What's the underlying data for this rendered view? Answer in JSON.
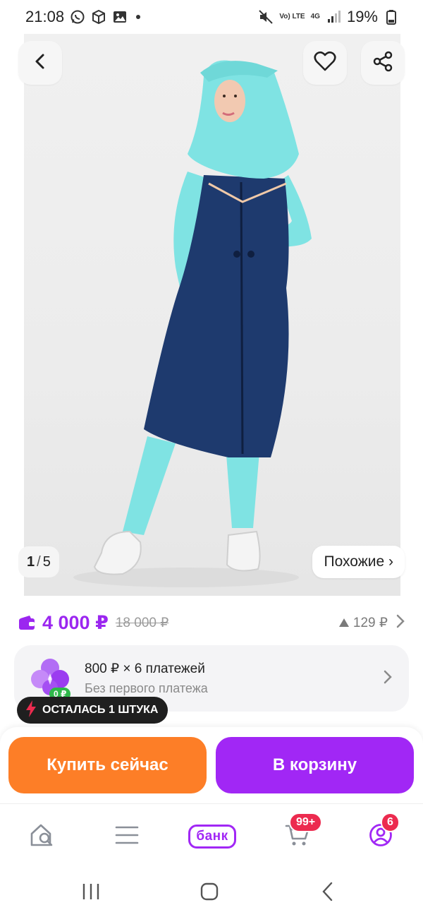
{
  "status_bar": {
    "time": "21:08",
    "battery": "19%",
    "network": "4G",
    "volte": "Vo) LTE"
  },
  "gallery": {
    "current": "1",
    "separator": "/",
    "total": "5",
    "similar_label": "Похожие ›"
  },
  "product": {
    "price": "4 000 ₽",
    "old_price": "18 000 ₽",
    "points": "129 ₽",
    "colors": {
      "price": "#9b26f0",
      "outfit_dark": "#1e3a6e",
      "outfit_light": "#7fe3e3"
    }
  },
  "installment": {
    "title": "800 ₽ × 6 платежей",
    "subtitle": "Без первого платежа",
    "badge": "0 ₽"
  },
  "stock": {
    "label": "ОСТАЛАСЬ 1 ШТУКА"
  },
  "actions": {
    "buy_now": "Купить сейчас",
    "add_to_cart": "В корзину",
    "colors": {
      "buy": "#fd7e27",
      "cart": "#a127f5"
    }
  },
  "bottom_nav": {
    "bank_label": "банк",
    "cart_badge": "99+",
    "profile_badge": "6"
  }
}
